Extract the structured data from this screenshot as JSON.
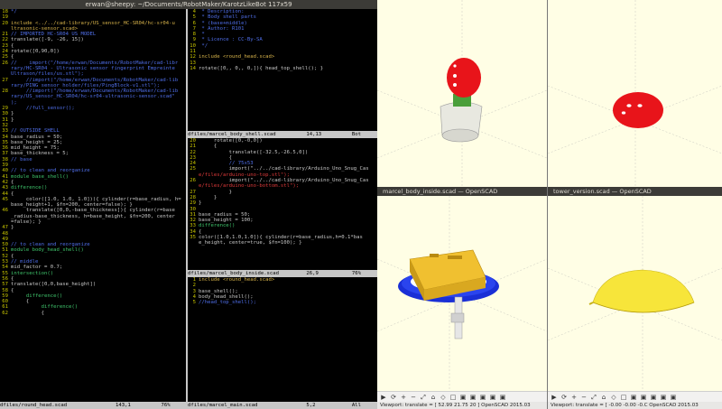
{
  "terminal": {
    "title": "erwan@sheepy: ~/Documents/RobotMaker/KarotzLikeBot 117x59",
    "left_pane": {
      "lines": [
        {
          "n": "18",
          "t": "*/",
          "cls": "c-com"
        },
        {
          "n": "19",
          "t": "",
          "cls": ""
        },
        {
          "n": "20",
          "t": "include <../../cad-library/US_sensor_HC-SR04/hc-sr04-u",
          "cls": "c-inc"
        },
        {
          "n": "",
          "t": "ltrasonic-sensor.scad>",
          "cls": "c-inc"
        },
        {
          "n": "21",
          "t": "// IMPORTED HC-SR04 US MODEL",
          "cls": "c-com"
        },
        {
          "n": "22",
          "t": "translate([-9, -26, 15])",
          "cls": ""
        },
        {
          "n": "23",
          "t": "{",
          "cls": ""
        },
        {
          "n": "24",
          "t": "rotate([0,90,0])",
          "cls": ""
        },
        {
          "n": "25",
          "t": "{",
          "cls": ""
        },
        {
          "n": "26",
          "t": "//    import(\"/home/erwan/Documents/RobotMaker/cad-libr",
          "cls": "c-com"
        },
        {
          "n": "",
          "t": "rary/HC-SR04 - Ultrasonic sensor fingerprint Empreinte",
          "cls": "c-com"
        },
        {
          "n": "",
          "t": "Ultrason/files/us.stl\");",
          "cls": "c-com"
        },
        {
          "n": "27",
          "t": "     //import(\"/home/erwan/Documents/RobotMaker/cad-lib",
          "cls": "c-com"
        },
        {
          "n": "",
          "t": "rary/PING sensor holder/files/PingBlock-v1.stl\");",
          "cls": "c-com"
        },
        {
          "n": "28",
          "t": "     //import(\"/home/erwan/Documents/RobotMaker/cad-lib",
          "cls": "c-com"
        },
        {
          "n": "",
          "t": "rary/US_sensor_HC-SR04/hc-sr04-ultrasonic-sensor.scad\"",
          "cls": "c-com"
        },
        {
          "n": "",
          "t": ");",
          "cls": "c-com"
        },
        {
          "n": "29",
          "t": "     //full_sensor();",
          "cls": "c-com"
        },
        {
          "n": "30",
          "t": "}",
          "cls": ""
        },
        {
          "n": "31",
          "t": "}",
          "cls": ""
        },
        {
          "n": "32",
          "t": "",
          "cls": ""
        },
        {
          "n": "33",
          "t": "// OUTSIDE SHELL",
          "cls": "c-com"
        },
        {
          "n": "34",
          "t": "base_radius = 50;",
          "cls": ""
        },
        {
          "n": "35",
          "t": "base_height = 25;",
          "cls": ""
        },
        {
          "n": "36",
          "t": "mid_height = 75;",
          "cls": ""
        },
        {
          "n": "37",
          "t": "base_thickness = 5;",
          "cls": ""
        },
        {
          "n": "38",
          "t": "// base",
          "cls": "c-com"
        },
        {
          "n": "39",
          "t": "",
          "cls": ""
        },
        {
          "n": "40",
          "t": "// to clean and reorganize",
          "cls": "c-com"
        },
        {
          "n": "41",
          "t": "module base_shell()",
          "cls": "c-kw"
        },
        {
          "n": "42",
          "t": "{",
          "cls": ""
        },
        {
          "n": "43",
          "t": "difference()",
          "cls": "c-kw"
        },
        {
          "n": "44",
          "t": "{",
          "cls": ""
        },
        {
          "n": "45",
          "t": "     color([1.0, 1.0, 1.0])){ cylinder(r=base_radius, h=",
          "cls": ""
        },
        {
          "n": "",
          "t": "base_height+1, $fn=200, center=false); }",
          "cls": ""
        },
        {
          "n": "46",
          "t": "     translate([0,0,-base_thickness]){ cylinder(r=base",
          "cls": ""
        },
        {
          "n": "",
          "t": "_radius-base_thickness, h=base_height, $fn=200, center",
          "cls": ""
        },
        {
          "n": "",
          "t": "=false); }",
          "cls": ""
        },
        {
          "n": "47",
          "t": "}",
          "cls": ""
        },
        {
          "n": "48",
          "t": "",
          "cls": ""
        },
        {
          "n": "49",
          "t": "",
          "cls": ""
        },
        {
          "n": "50",
          "t": "// to clean and reorganize",
          "cls": "c-com"
        },
        {
          "n": "51",
          "t": "module body_head_shell()",
          "cls": "c-kw"
        },
        {
          "n": "52",
          "t": "{",
          "cls": ""
        },
        {
          "n": "53",
          "t": "// middle",
          "cls": "c-com"
        },
        {
          "n": "54",
          "t": "mid_factor = 0.7;",
          "cls": ""
        },
        {
          "n": "55",
          "t": "intersection()",
          "cls": "c-kw"
        },
        {
          "n": "56",
          "t": "{",
          "cls": ""
        },
        {
          "n": "57",
          "t": "translate([0,0,base_height])",
          "cls": ""
        },
        {
          "n": "58",
          "t": "{",
          "cls": ""
        },
        {
          "n": "59",
          "t": "     difference()",
          "cls": "c-kw"
        },
        {
          "n": "60",
          "t": "     {",
          "cls": ""
        },
        {
          "n": "61",
          "t": "          difference()",
          "cls": "c-kw"
        },
        {
          "n": "62",
          "t": "          {",
          "cls": ""
        }
      ],
      "status": "dfiles/round_head.scad                143,1          76%"
    },
    "right_top": {
      "lines": [
        {
          "n": "4",
          "t": " * Description:",
          "cls": "c-com"
        },
        {
          "n": "5",
          "t": " * Body shell parts",
          "cls": "c-com"
        },
        {
          "n": "6",
          "t": " * (base+middle)",
          "cls": "c-com"
        },
        {
          "n": "7",
          "t": " * Author: R101",
          "cls": "c-com"
        },
        {
          "n": "8",
          "t": " *",
          "cls": "c-com"
        },
        {
          "n": "9",
          "t": " * Licence : CC-By-SA",
          "cls": "c-com"
        },
        {
          "n": "10",
          "t": " */",
          "cls": "c-com"
        },
        {
          "n": "11",
          "t": "",
          "cls": ""
        },
        {
          "n": "12",
          "t": "include <round_head.scad>",
          "cls": "c-inc"
        },
        {
          "n": "13",
          "t": "",
          "cls": ""
        },
        {
          "n": "14",
          "t": "rotate([0,, 0,, 0,]){ head_top_shell(); }",
          "cls": ""
        }
      ],
      "status": "dfiles/marcel_body_shell.scad          14,13          Bot"
    },
    "right_mid": {
      "lines": [
        {
          "n": "20",
          "t": "     rotate([0,-0,0])",
          "cls": ""
        },
        {
          "n": "21",
          "t": "     {",
          "cls": ""
        },
        {
          "n": "22",
          "t": "          translate([-32.5,-26.5,0])",
          "cls": ""
        },
        {
          "n": "23",
          "t": "          {",
          "cls": ""
        },
        {
          "n": "24",
          "t": "          // 75x53",
          "cls": "c-com"
        },
        {
          "n": "25",
          "t": "          import(\"../../cad-library/Arduino_Uno_Snug_Cas",
          "cls": ""
        },
        {
          "n": "",
          "t": "e/files/arduino-uno-top.stl\");",
          "cls": "c-str"
        },
        {
          "n": "26",
          "t": "          import(\"../../cad-library/Arduino_Uno_Snug_Cas",
          "cls": ""
        },
        {
          "n": "",
          "t": "e/files/arduino-uno-bottom.stl\");",
          "cls": "c-str"
        },
        {
          "n": "27",
          "t": "          }",
          "cls": ""
        },
        {
          "n": "28",
          "t": "     }",
          "cls": ""
        },
        {
          "n": "29",
          "t": "}",
          "cls": ""
        },
        {
          "n": "30",
          "t": "",
          "cls": ""
        },
        {
          "n": "31",
          "t": "base_radius = 50;",
          "cls": ""
        },
        {
          "n": "32",
          "t": "base_height = 100;",
          "cls": ""
        },
        {
          "n": "33",
          "t": "difference()",
          "cls": "c-kw"
        },
        {
          "n": "34",
          "t": "{",
          "cls": ""
        },
        {
          "n": "35",
          "t": "color([1.0,1.0,1.0]){ cylinder(r=base_radius,h=0.1*bas",
          "cls": ""
        },
        {
          "n": "",
          "t": "e_height, center=true, $fn=100); }",
          "cls": ""
        }
      ],
      "status": "dfiles/marcel_body_inside.scad         26,9           76%"
    },
    "right_bot": {
      "lines": [
        {
          "n": "1",
          "t": "include <round_head.scad>",
          "cls": "c-inc"
        },
        {
          "n": "2",
          "t": "",
          "cls": ""
        },
        {
          "n": "3",
          "t": "base_shell();",
          "cls": ""
        },
        {
          "n": "4",
          "t": "body_head_shell();",
          "cls": ""
        },
        {
          "n": "5",
          "t": "//head_top_shell();",
          "cls": "c-com"
        }
      ],
      "status": "dfiles/marcel_main.scad                5,2            All"
    }
  },
  "scad_windows": [
    {
      "title": "",
      "status": ""
    },
    {
      "title": "",
      "status": ""
    },
    {
      "title": "marcel_body_inside.scad — OpenSCAD",
      "status": "Viewport: translate = [ 52.99 21.75 20 ]  OpenSCAD 2015.03"
    },
    {
      "title": "tower_version.scad — OpenSCAD",
      "status": "Viewport: translate = [ -0.00 -0.00 -0.C  OpenSCAD 2015.03"
    }
  ],
  "colors": {
    "viewport_bg": "#fffee5",
    "red_head": "#e8141a",
    "yellow_shell": "#f7e53a",
    "blue_base": "#1a2fd6",
    "arduino": "#f0c030"
  },
  "toolbar_icons": [
    "play-icon",
    "rotate-icon",
    "zoom-in-icon",
    "zoom-out-icon",
    "zoom-fit-icon",
    "reset-view-icon",
    "perspective-icon",
    "ortho-icon",
    "view-icon",
    "view-icon",
    "view-icon",
    "view-icon",
    "view-icon"
  ]
}
